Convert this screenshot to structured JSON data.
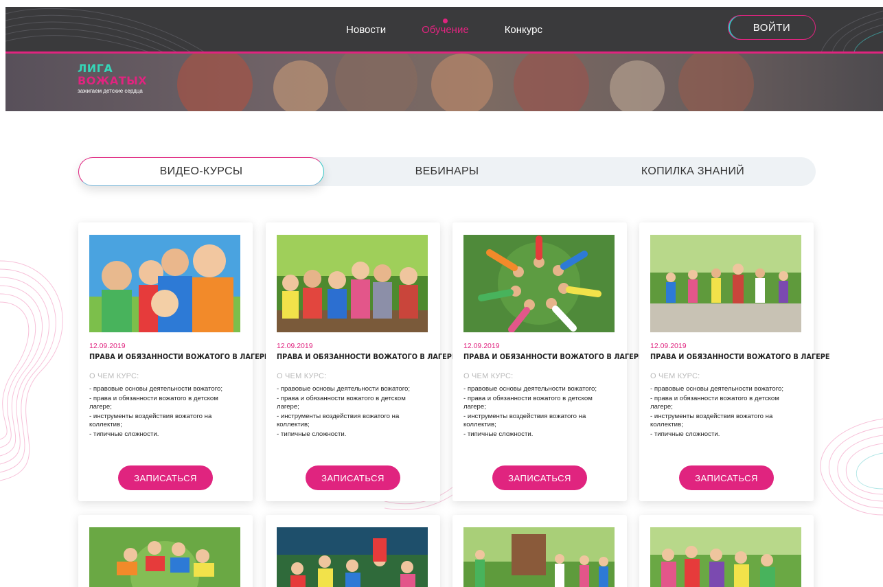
{
  "nav": {
    "items": [
      {
        "label": "Новости",
        "active": false
      },
      {
        "label": "Обучение",
        "active": true
      },
      {
        "label": "Конкурс",
        "active": false
      }
    ],
    "login_label": "ВОЙТИ"
  },
  "logo": {
    "line1": "ЛИГА",
    "line2": "ВОЖАТЫХ",
    "tagline": "зажигаем детские сердца"
  },
  "tabs": [
    {
      "label": "ВИДЕО-КУРСЫ",
      "active": true
    },
    {
      "label": "ВЕБИНАРЫ",
      "active": false
    },
    {
      "label": "КОПИЛКА ЗНАНИЙ",
      "active": false
    }
  ],
  "cards": [
    {
      "date": "12.09.2019",
      "title": "ПРАВА И ОБЯЗАННОСТИ ВОЖАТОГО В ЛАГЕРЕ",
      "about": "О ЧЕМ КУРС:",
      "points": [
        "- правовые основы деятельности вожатого;",
        "- права и обязанности вожатого в детском лагере;",
        "- инструменты воздействия вожатого на коллектив;",
        "- типичные сложности."
      ],
      "button": "ЗАПИСАТЬСЯ",
      "image": "children-selfie-photo"
    },
    {
      "date": "12.09.2019",
      "title": "ПРАВА И ОБЯЗАННОСТИ ВОЖАТОГО В ЛАГЕРЕ",
      "about": "О ЧЕМ КУРС:",
      "points": [
        "- правовые основы деятельности вожатого;",
        "- права и обязанности вожатого в детском лагере;",
        "- инструменты воздействия вожатого на коллектив;",
        "- типичные сложности."
      ],
      "button": "ЗАПИСАТЬСЯ",
      "image": "children-on-bench-photo"
    },
    {
      "date": "12.09.2019",
      "title": "ПРАВА И ОБЯЗАННОСТИ ВОЖАТОГО В ЛАГЕРЕ",
      "about": "О ЧЕМ КУРС:",
      "points": [
        "- правовые основы деятельности вожатого;",
        "- права и обязанности вожатого в детском лагере;",
        "- инструменты воздействия вожатого на коллектив;",
        "- типичные сложности."
      ],
      "button": "ЗАПИСАТЬСЯ",
      "image": "children-circle-on-grass-photo"
    },
    {
      "date": "12.09.2019",
      "title": "ПРАВА И ОБЯЗАННОСТИ ВОЖАТОГО В ЛАГЕРЕ",
      "about": "О ЧЕМ КУРС:",
      "points": [
        "- правовые основы деятельности вожатого;",
        "- права и обязанности вожатого в детском лагере;",
        "- инструменты воздействия вожатого на коллектив;",
        "- типичные сложности."
      ],
      "button": "ЗАПИСАТЬСЯ",
      "image": "children-running-photo"
    }
  ],
  "colors": {
    "accent_pink": "#e0247f",
    "accent_teal": "#35c6c6",
    "header_bg": "#3a3a3c"
  }
}
